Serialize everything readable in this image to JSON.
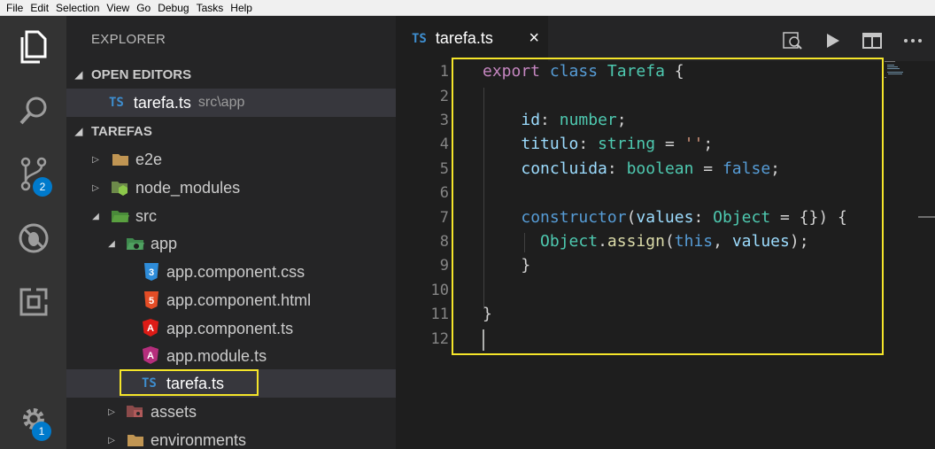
{
  "menu": [
    "File",
    "Edit",
    "Selection",
    "View",
    "Go",
    "Debug",
    "Tasks",
    "Help"
  ],
  "activity": {
    "icons": [
      "explorer-icon",
      "search-icon",
      "source-control-icon",
      "debug-icon",
      "extensions-icon",
      "settings-gear-icon"
    ],
    "scm_badge": "2",
    "settings_badge": "1",
    "badge_color": "#007acc"
  },
  "sidebar": {
    "title": "EXPLORER",
    "open_editors": {
      "header": "OPEN EDITORS",
      "items": [
        {
          "icon_label": "TS",
          "name": "tarefa.ts",
          "path": "src\\app"
        }
      ]
    },
    "project": {
      "header": "TAREFAS",
      "tree": [
        {
          "name": "e2e",
          "icon": "folder-icon",
          "twisty": "▷"
        },
        {
          "name": "node_modules",
          "icon": "node-folder-icon",
          "twisty": "▷"
        },
        {
          "name": "src",
          "icon": "src-folder-icon",
          "twisty": "◢"
        },
        {
          "name": "app",
          "icon": "app-folder-icon",
          "twisty": "◢"
        },
        {
          "name": "app.component.css",
          "icon": "css-icon",
          "icon_label": "3"
        },
        {
          "name": "app.component.html",
          "icon": "html-icon",
          "icon_label": "5"
        },
        {
          "name": "app.component.ts",
          "icon": "angular-icon",
          "icon_label": "A"
        },
        {
          "name": "app.module.ts",
          "icon": "angular-module-icon",
          "icon_label": "A"
        },
        {
          "name": "tarefa.ts",
          "icon": "typescript-icon",
          "icon_label": "TS"
        },
        {
          "name": "assets",
          "icon": "assets-folder-icon",
          "twisty": "▷"
        },
        {
          "name": "environments",
          "icon": "folder-icon",
          "twisty": "▷"
        }
      ]
    }
  },
  "editor": {
    "tab": {
      "icon_label": "TS",
      "label": "tarefa.ts",
      "close": "×"
    },
    "toolbar": [
      "open-changes-icon",
      "run-icon",
      "split-editor-icon",
      "more-icon"
    ],
    "line_numbers": [
      "1",
      "2",
      "3",
      "4",
      "5",
      "6",
      "7",
      "8",
      "9",
      "10",
      "11",
      "12"
    ],
    "highlight_color": "#f5e52a"
  }
}
